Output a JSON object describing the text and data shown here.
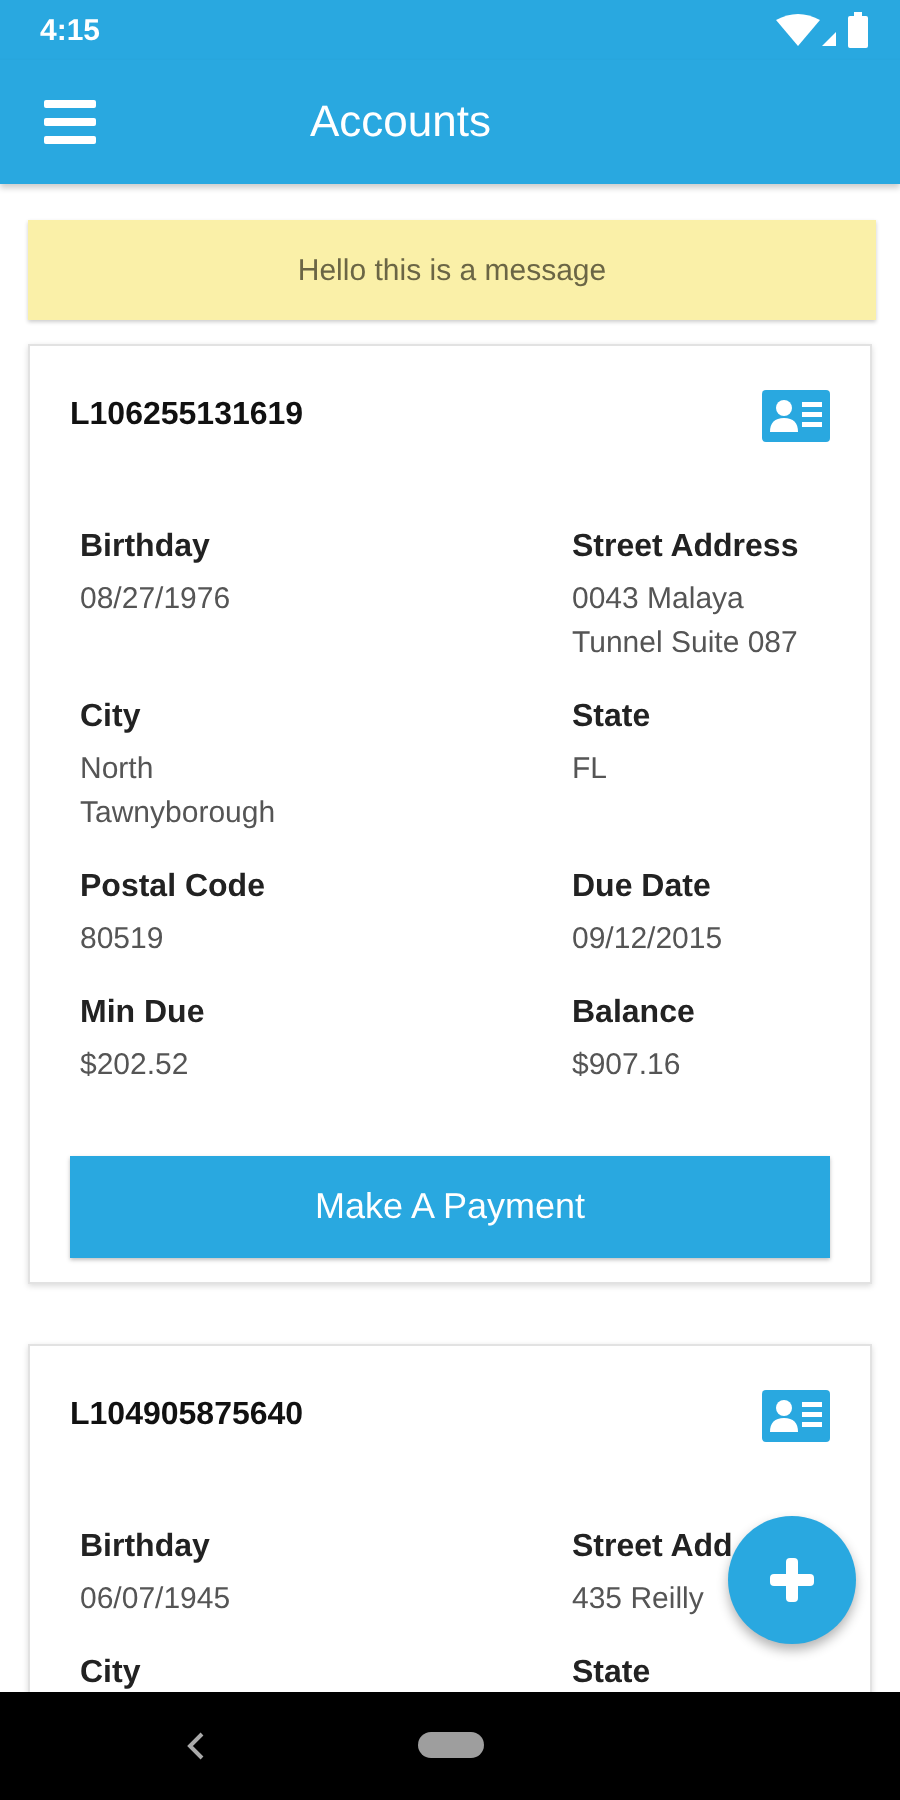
{
  "status_bar": {
    "time": "4:15"
  },
  "app_bar": {
    "title": "Accounts"
  },
  "message": "Hello this is a message",
  "accounts": [
    {
      "id": "L106255131619",
      "fields": [
        {
          "label": "Birthday",
          "value": [
            "08/27/1976"
          ]
        },
        {
          "label": "Street Address",
          "value": [
            "0043 Malaya",
            "Tunnel Suite 087"
          ]
        },
        {
          "label": "City",
          "value": [
            "North",
            "Tawnyborough"
          ]
        },
        {
          "label": "State",
          "value": [
            "FL"
          ]
        },
        {
          "label": "Postal Code",
          "value": [
            "80519"
          ]
        },
        {
          "label": "Due Date",
          "value": [
            "09/12/2015"
          ]
        },
        {
          "label": "Min Due",
          "value": [
            "$202.52"
          ]
        },
        {
          "label": "Balance",
          "value": [
            "$907.16"
          ]
        }
      ],
      "button": "Make A Payment"
    },
    {
      "id": "L104905875640",
      "fields": [
        {
          "label": "Birthday",
          "value": [
            "06/07/1945"
          ]
        },
        {
          "label": "Street Add",
          "value": [
            "435 Reilly"
          ]
        },
        {
          "label": "City"
        },
        {
          "label": "State"
        }
      ]
    }
  ]
}
